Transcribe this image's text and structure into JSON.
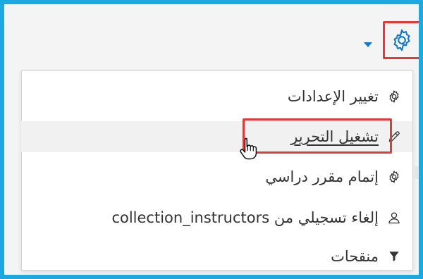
{
  "toolbar": {
    "settings_icon": "gear-icon",
    "dropdown_icon": "caret-down-icon",
    "accent_color": "#1177d1",
    "highlight_color": "#e03a3a"
  },
  "menu": {
    "items": [
      {
        "label": "تغيير الإعدادات",
        "icon": "gear-icon"
      },
      {
        "label": "تشغيل التحرير",
        "icon": "pencil-icon",
        "highlighted": true,
        "hovered": true
      },
      {
        "label": "إتمام مقرر دراسي",
        "icon": "gear-icon"
      },
      {
        "label": "إلغاء تسجيلي من collection_instructors",
        "icon": "user-icon"
      },
      {
        "label": "منقحات",
        "icon": "filter-icon"
      }
    ]
  },
  "frame": {
    "border_color": "#1ea8e0"
  }
}
